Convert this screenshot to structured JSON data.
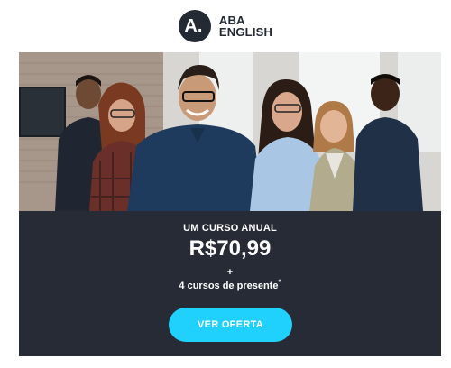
{
  "brand": {
    "logo_letter": "A.",
    "name_line1": "ABA",
    "name_line2": "ENGLISH",
    "accent_color": "#1fd1fc",
    "dark_color": "#262b36"
  },
  "hero": {
    "image": "photo-group-of-smiling-people"
  },
  "offer": {
    "label": "UM CURSO ANUAL",
    "price": "R$70,99",
    "plus": "+",
    "gift_text": "4 cursos de presente",
    "gift_mark": "*",
    "cta_label": "VER OFERTA"
  }
}
